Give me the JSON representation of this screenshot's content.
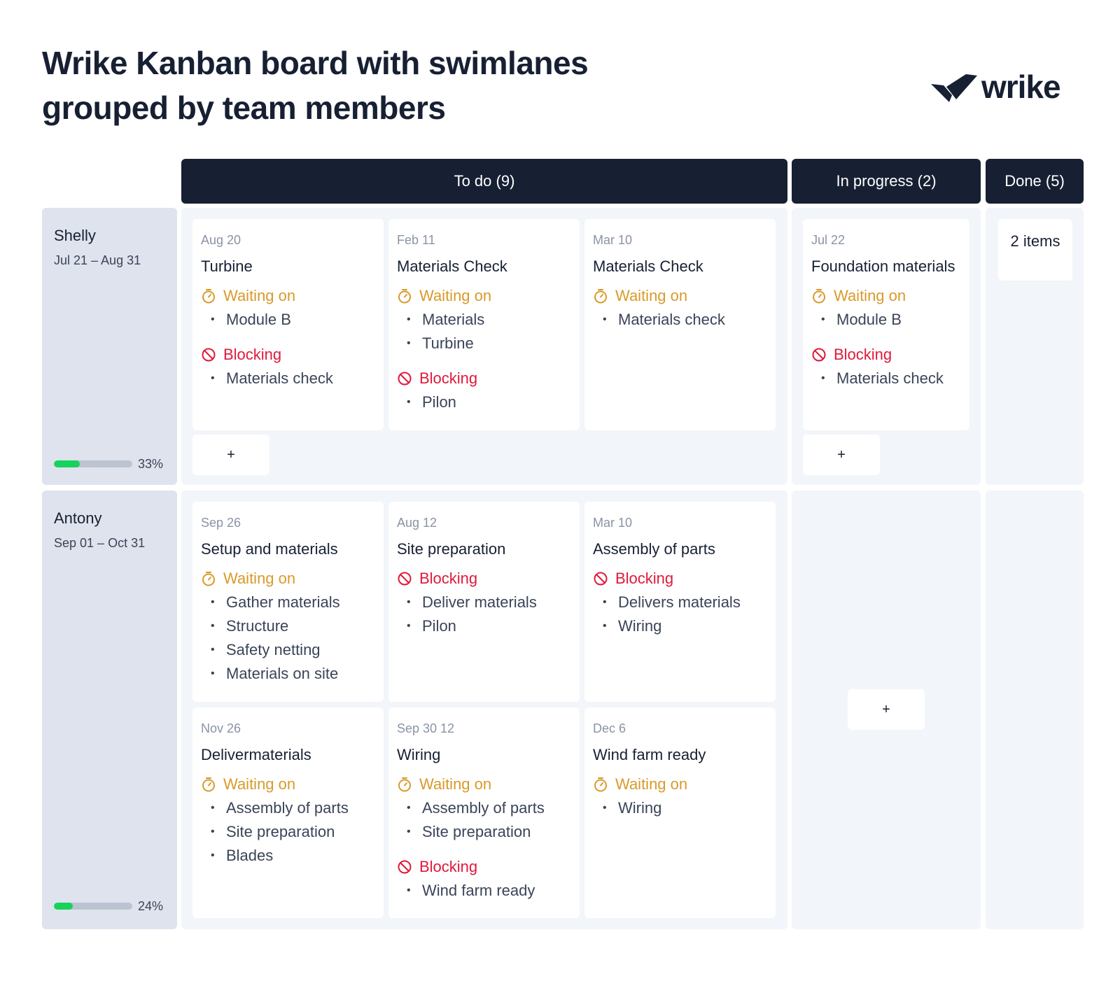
{
  "title": "Wrike Kanban board with swimlanes grouped by team members",
  "logo_text": "wrike",
  "columns": {
    "todo": "To do (9)",
    "inprogress": "In progress (2)",
    "done": "Done (5)"
  },
  "colors": {
    "header": "#172033",
    "waiting": "#d99a2b",
    "blocking": "#e0193b",
    "progress": "#16d35b"
  },
  "section_labels": {
    "waiting": "Waiting on",
    "blocking": "Blocking"
  },
  "add_label": "+",
  "lanes": [
    {
      "name": "Shelly",
      "dates": "Jul 21 – Aug 31",
      "progress": 33,
      "progress_label": "33%",
      "cards": [
        {
          "date": "Aug 20",
          "title": "Turbine",
          "waiting": [
            "Module B"
          ],
          "blocking": [
            "Materials check"
          ]
        },
        {
          "date": "Feb 11",
          "title": "Materials Check",
          "waiting": [
            "Materials",
            "Turbine"
          ],
          "blocking": [
            "Pilon"
          ]
        },
        {
          "date": "Mar 10",
          "title": "Materials Check",
          "waiting": [
            "Materials check"
          ],
          "blocking": []
        },
        {
          "date": "Jul 22",
          "title": "Foundation materials",
          "waiting": [
            "Module B"
          ],
          "blocking": [
            "Materials check"
          ]
        }
      ],
      "done_summary": "2 items"
    },
    {
      "name": "Antony",
      "dates": "Sep 01 – Oct 31",
      "progress": 24,
      "progress_label": "24%",
      "cards": [
        {
          "date": "Sep 26",
          "title": "Setup and materials",
          "waiting": [
            "Gather materials",
            "Structure",
            "Safety netting",
            "Materials on site"
          ],
          "blocking": []
        },
        {
          "date": "Aug 12",
          "title": "Site preparation",
          "waiting": [],
          "blocking": [
            "Deliver materials",
            "Pilon"
          ]
        },
        {
          "date": "Mar 10",
          "title": "Assembly of parts",
          "waiting": [],
          "blocking": [
            "Delivers materials",
            "Wiring"
          ]
        },
        {
          "date": "Nov 26",
          "title": "Delivermaterials",
          "waiting": [
            "Assembly of parts",
            "Site preparation",
            "Blades"
          ],
          "blocking": []
        },
        {
          "date": "Sep 30 12",
          "title": "Wiring",
          "waiting": [
            "Assembly of parts",
            "Site preparation"
          ],
          "blocking": [
            "Wind farm ready"
          ]
        },
        {
          "date": "Dec 6",
          "title": "Wind farm ready",
          "waiting": [
            "Wiring"
          ],
          "blocking": []
        }
      ]
    }
  ]
}
